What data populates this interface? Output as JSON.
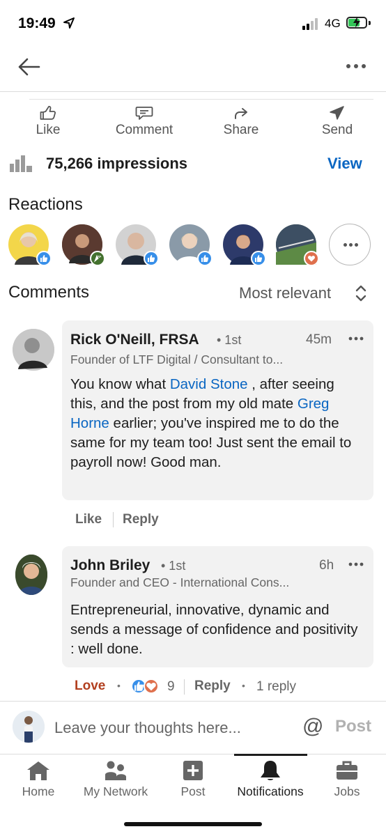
{
  "status_bar": {
    "time": "19:49",
    "network": "4G",
    "battery_color": "#34c759"
  },
  "nav": {
    "back_icon": "back-arrow-icon",
    "more_icon": "more-horizontal-icon"
  },
  "actions": {
    "like": "Like",
    "comment": "Comment",
    "share": "Share",
    "send": "Send"
  },
  "impressions": {
    "text": "75,266 impressions",
    "view_label": "View"
  },
  "reactions": {
    "title": "Reactions",
    "reactors": [
      {
        "badge": "like",
        "bg": "#f3d64a"
      },
      {
        "badge": "celebrate",
        "bg": "#7a4a3a"
      },
      {
        "badge": "like",
        "bg": "#c9c9c9"
      },
      {
        "badge": "like",
        "bg": "#8a9aa8"
      },
      {
        "badge": "like",
        "bg": "#2d3a6a"
      },
      {
        "badge": "love",
        "bg": "#4c6a4a"
      }
    ]
  },
  "comments": {
    "title": "Comments",
    "sort_label": "Most relevant",
    "items": [
      {
        "name": "Rick O'Neill, FRSA",
        "degree": "• 1st",
        "time": "45m",
        "headline": "Founder of LTF Digital / Consultant to...",
        "body_1": "You know what ",
        "mention_1": "David Stone",
        "body_2": " , after seeing this, and the post from my old mate ",
        "mention_2": "Greg Horne",
        "body_3": " earlier; you've inspired me to do the same for my team too! Just sent the email to payroll now! Good man.",
        "like_label": "Like",
        "reply_label": "Reply"
      },
      {
        "name": "John Briley",
        "degree": "• 1st",
        "time": "6h",
        "headline": "Founder and CEO - International Cons...",
        "body": "Entrepreneurial, innovative, dynamic and sends a message of confidence and positivity : well done.",
        "reaction_label": "Love",
        "reaction_count": "9",
        "reply_label": "Reply",
        "replies_label": "1 reply",
        "love_color": "#b24020"
      }
    ]
  },
  "composer": {
    "placeholder": "Leave your thoughts here...",
    "at_symbol": "@",
    "post_label": "Post"
  },
  "tabs": [
    {
      "label": "Home",
      "icon": "home-icon"
    },
    {
      "label": "My Network",
      "icon": "network-icon"
    },
    {
      "label": "Post",
      "icon": "plus-icon"
    },
    {
      "label": "Notifications",
      "icon": "bell-icon",
      "active": true
    },
    {
      "label": "Jobs",
      "icon": "briefcase-icon"
    }
  ],
  "colors": {
    "accent": "#0a66c2",
    "like_blue": "#378fe9",
    "love_orange": "#df704d",
    "celebrate_green": "#44712e"
  }
}
